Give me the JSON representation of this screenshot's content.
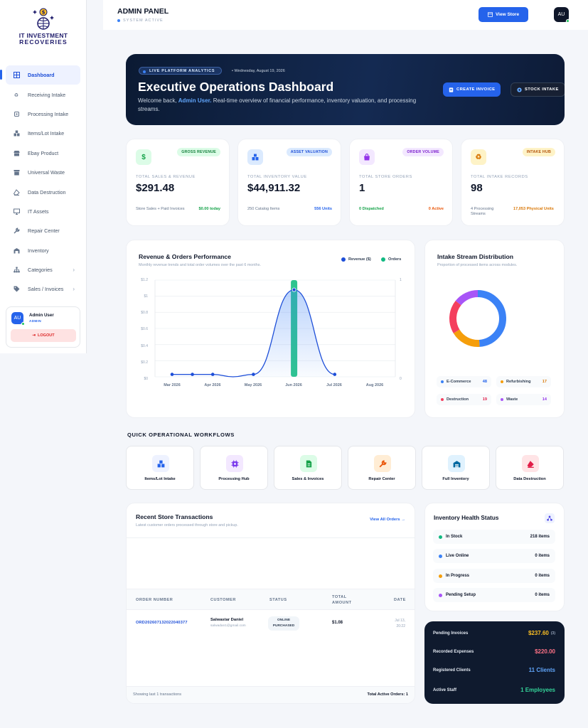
{
  "sidebar": {
    "brand_line1": "IT INVESTMENT",
    "brand_line2": "RECOVERIES",
    "items": [
      {
        "label": "Dashboard",
        "icon": "grid-icon",
        "active": true
      },
      {
        "label": "Receiving Intake",
        "icon": "recycle-icon"
      },
      {
        "label": "Processing Intake",
        "icon": "chip-icon"
      },
      {
        "label": "Items/Lot Intake",
        "icon": "boxes-icon"
      },
      {
        "label": "Ebay Product",
        "icon": "store-icon"
      },
      {
        "label": "Universal Waste",
        "icon": "bin-icon"
      },
      {
        "label": "Data Destruction",
        "icon": "eraser-icon"
      },
      {
        "label": "IT Assets",
        "icon": "monitor-icon"
      },
      {
        "label": "Repair Center",
        "icon": "wrench-icon"
      },
      {
        "label": "Inventory",
        "icon": "warehouse-icon"
      },
      {
        "label": "Categories",
        "icon": "sitemap-icon"
      },
      {
        "label": "Sales / Invoices",
        "icon": "tag-icon"
      }
    ],
    "user": {
      "initials": "AU",
      "name": "Admin User",
      "role": "ADMIN",
      "logout": "LOGOUT"
    }
  },
  "topbar": {
    "title": "ADMIN PANEL",
    "status": "SYSTEM ACTIVE",
    "view_store": "View Store",
    "avatar": "AU"
  },
  "hero": {
    "pill": "LIVE PLATFORM ANALYTICS",
    "date": "• Wednesday, August 19, 2026",
    "title": "Executive Operations Dashboard",
    "welcome": "Welcome back,",
    "user": "Admin User.",
    "subtitle": "Real-time overview of financial performance, inventory valuation, and processing streams.",
    "btn_invoice": "CREATE INVOICE",
    "btn_stock": "STOCK INTAKE"
  },
  "stats": [
    {
      "badge": "GROSS REVENUE",
      "label": "TOTAL SALES & REVENUE",
      "value": "$291.48",
      "foot_left": "Store Sales + Paid Invoices",
      "foot_right": "$0.00 today",
      "icon": "dollar-icon",
      "color": "#16a34a",
      "bg": "#dcfce7"
    },
    {
      "badge": "ASSET VALUATION",
      "label": "TOTAL INVENTORY VALUE",
      "value": "$44,911.32",
      "foot_left": "250 Catalog Items",
      "foot_right": "556 Units",
      "icon": "boxes-icon",
      "color": "#2563eb",
      "bg": "#dbeafe"
    },
    {
      "badge": "ORDER VOLUME",
      "label": "TOTAL STORE ORDERS",
      "value": "1",
      "foot_left": "0 Dispatched",
      "foot_right": "0 Active",
      "icon": "bag-icon",
      "color": "#9333ea",
      "bg": "#f3e8ff"
    },
    {
      "badge": "INTAKE HUB",
      "label": "TOTAL INTAKE RECORDS",
      "value": "98",
      "foot_left": "4 Processing Streams",
      "foot_right": "17,053 Physical Units",
      "icon": "recycle-icon",
      "color": "#d97706",
      "bg": "#fef3c7"
    }
  ],
  "revenue_chart": {
    "title": "Revenue & Orders Performance",
    "subtitle": "Monthly revenue trends and total order volumes over the past 6 months.",
    "legend_revenue": "Revenue ($)",
    "legend_orders": "Orders",
    "y_ticks": [
      "$1.2",
      "$1",
      "$0.8",
      "$0.6",
      "$0.4",
      "$0.2",
      "$0"
    ],
    "y2_ticks": [
      "1",
      "0"
    ],
    "colors": {
      "revenue": "#1d4ed8",
      "orders": "#10b981"
    }
  },
  "chart_data": [
    {
      "type": "line",
      "title": "Revenue & Orders Performance",
      "categories": [
        "Mar 2026",
        "Apr 2026",
        "May 2026",
        "Jun 2026",
        "Jul 2026",
        "Aug 2026"
      ],
      "series": [
        {
          "name": "Revenue ($)",
          "axis": "left",
          "values": [
            0,
            0,
            0,
            0,
            0,
            1.08,
            0
          ],
          "x": [
            "Mar 2026",
            "",
            "Apr 2026",
            "",
            "May 2026",
            "Jun 2026",
            "Jul 2026"
          ],
          "points": [
            [
              0,
              0.03
            ],
            [
              0.5,
              0.03
            ],
            [
              1,
              0.03
            ],
            [
              1.5,
              0.0
            ],
            [
              2,
              0.03
            ],
            [
              3,
              1.08
            ],
            [
              4,
              0.03
            ]
          ]
        },
        {
          "name": "Orders",
          "axis": "right",
          "type": "bar",
          "values": [
            0,
            0,
            0,
            1,
            0,
            0
          ]
        }
      ],
      "ylim": [
        0,
        1.2
      ],
      "y2lim": [
        0,
        1
      ]
    },
    {
      "type": "pie",
      "title": "Intake Stream Distribution",
      "categories": [
        "E-Commerce",
        "Refurbishing",
        "Destruction",
        "Waste"
      ],
      "values": [
        48,
        17,
        19,
        14
      ],
      "colors": [
        "#3b82f6",
        "#f59e0b",
        "#f43f5e",
        "#a855f7"
      ]
    }
  ],
  "distribution": {
    "title": "Intake Stream Distribution",
    "subtitle": "Proportion of processed items across modules.",
    "items": [
      {
        "name": "E-Commerce",
        "value": "48",
        "color": "#3b82f6",
        "text": "#2563eb"
      },
      {
        "name": "Refurbishing",
        "value": "17",
        "color": "#f59e0b",
        "text": "#d97706"
      },
      {
        "name": "Destruction",
        "value": "19",
        "color": "#f43f5e",
        "text": "#e11d48"
      },
      {
        "name": "Waste",
        "value": "14",
        "color": "#a855f7",
        "text": "#9333ea"
      }
    ]
  },
  "workflows": {
    "title": "QUICK OPERATIONAL WORKFLOWS",
    "items": [
      {
        "label": "Items/Lot Intake",
        "icon": "boxes-icon",
        "color": "#2563eb",
        "bg": "#eef2ff"
      },
      {
        "label": "Processing Hub",
        "icon": "chip-icon",
        "color": "#7c3aed",
        "bg": "#f3e8ff"
      },
      {
        "label": "Sales & Invoices",
        "icon": "invoice-icon",
        "color": "#16a34a",
        "bg": "#dcfce7"
      },
      {
        "label": "Repair Center",
        "icon": "wrench-icon",
        "color": "#ea580c",
        "bg": "#ffedd5"
      },
      {
        "label": "Full Inventory",
        "icon": "warehouse-icon",
        "color": "#0369a1",
        "bg": "#e0f2fe"
      },
      {
        "label": "Data Destruction",
        "icon": "eraser-icon",
        "color": "#e11d48",
        "bg": "#ffe4e6"
      }
    ]
  },
  "transactions": {
    "title": "Recent Store Transactions",
    "subtitle": "Latest customer orders processed through store and pickup.",
    "view_all": "View All Orders →",
    "headers": [
      "ORDER NUMBER",
      "CUSTOMER",
      "STATUS",
      "TOTAL AMOUNT",
      "DATE"
    ],
    "rows": [
      {
        "order": "ORD20260713202204037​7",
        "customer": "Salwastar Daniel",
        "email": "salwadan1@gmail.com",
        "status1": "ONLINE",
        "status2": "PURCHASED",
        "amount": "$1.08",
        "date1": "Jul 13,",
        "date2": "20:22"
      }
    ],
    "footer_left": "Showing last 1 transactions",
    "footer_right": "Total Active Orders: 1"
  },
  "health": {
    "title": "Inventory Health Status",
    "items": [
      {
        "name": "In Stock",
        "value": "218 items",
        "color": "#10b981"
      },
      {
        "name": "Live Online",
        "value": "0 items",
        "color": "#3b82f6"
      },
      {
        "name": "In Progress",
        "value": "0 items",
        "color": "#f59e0b"
      },
      {
        "name": "Pending Setup",
        "value": "0 items",
        "color": "#a855f7"
      }
    ]
  },
  "finance": [
    {
      "label": "Pending Invoices",
      "value": "$237.60",
      "suffix": "(3)",
      "color": "#fbbf24"
    },
    {
      "label": "Recorded Expenses",
      "value": "$220.00",
      "color": "#fb7185"
    },
    {
      "label": "Registered Clients",
      "value": "11 Clients",
      "color": "#60a5fa"
    },
    {
      "label": "Active Staff",
      "value": "1 Employees",
      "color": "#34d399"
    }
  ]
}
